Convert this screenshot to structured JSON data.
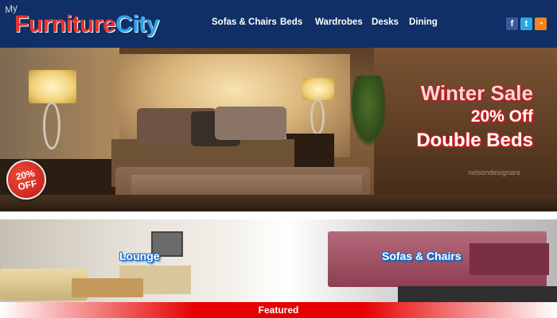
{
  "logo": {
    "my": "My",
    "word1": "Furniture",
    "word2": "City"
  },
  "nav": [
    "Sofas & Chairs",
    "Beds",
    "Wardrobes",
    "Desks",
    "Dining"
  ],
  "social": [
    {
      "icon": "facebook-icon",
      "glyph": "f",
      "color": "#3b5998"
    },
    {
      "icon": "twitter-icon",
      "glyph": "t",
      "color": "#29a9e0"
    },
    {
      "icon": "rss-icon",
      "glyph": "◔",
      "color": "#f5821f"
    }
  ],
  "banner": {
    "headline": "Winter Sale",
    "discount": "20% Off",
    "product": "Double Beds",
    "watermark": "nelsondesignare",
    "badge_line1": "20%",
    "badge_line2": "OFF"
  },
  "categories": {
    "lounge": "Lounge",
    "sofas": "Sofas & Chairs"
  },
  "featured": "Featured",
  "colors": {
    "header": "#0f2f66",
    "accent_red": "#e4342e",
    "accent_blue": "#2fa3e6",
    "featured_red": "#e60000"
  }
}
